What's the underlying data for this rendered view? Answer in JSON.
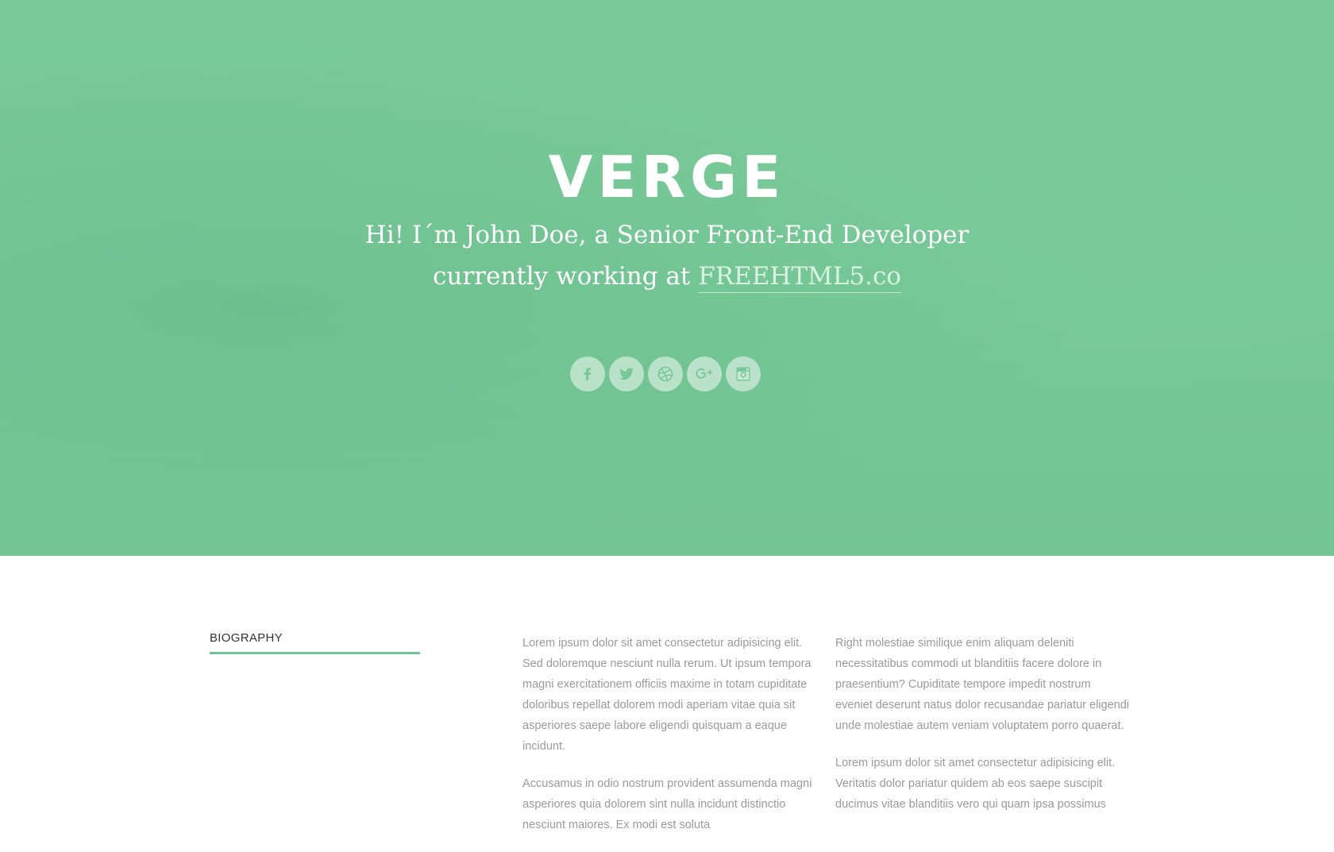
{
  "hero": {
    "title": "VERGE",
    "subtitle_line1": "Hi! I´m John Doe, a Senior Front-End Developer",
    "subtitle_line2_prefix": "currently working at ",
    "subtitle_link": "FREEHTML5.co",
    "background_color": "#77c797"
  },
  "social": [
    {
      "name": "facebook",
      "icon": "facebook-icon"
    },
    {
      "name": "twitter",
      "icon": "twitter-icon"
    },
    {
      "name": "dribbble",
      "icon": "dribbble-icon"
    },
    {
      "name": "google-plus",
      "icon": "google-plus-icon"
    },
    {
      "name": "instagram",
      "icon": "instagram-icon"
    }
  ],
  "biography": {
    "heading": "BIOGRAPHY",
    "accent_color": "#6ec592",
    "column1": [
      "Lorem ipsum dolor sit amet consectetur adipisicing elit. Sed doloremque nesciunt nulla rerum. Ut ipsum tempora magni exercitationem officiis maxime in totam cupiditate doloribus repellat dolorem modi aperiam vitae quia sit asperiores saepe labore eligendi quisquam a eaque incidunt.",
      "Accusamus in odio nostrum provident assumenda magni asperiores quia dolorem sint nulla incidunt distinctio nesciunt maiores. Ex modi est soluta"
    ],
    "column2": [
      "Right molestiae similique enim aliquam deleniti necessitatibus commodi ut blanditiis facere dolore in praesentium? Cupiditate tempore impedit nostrum eveniet deserunt natus dolor recusandae pariatur eligendi unde molestiae autem veniam voluptatem porro quaerat.",
      "Lorem ipsum dolor sit amet consectetur adipisicing elit. Veritatis dolor pariatur quidem ab eos saepe suscipit ducimus vitae blanditiis vero qui quam ipsa possimus"
    ]
  }
}
